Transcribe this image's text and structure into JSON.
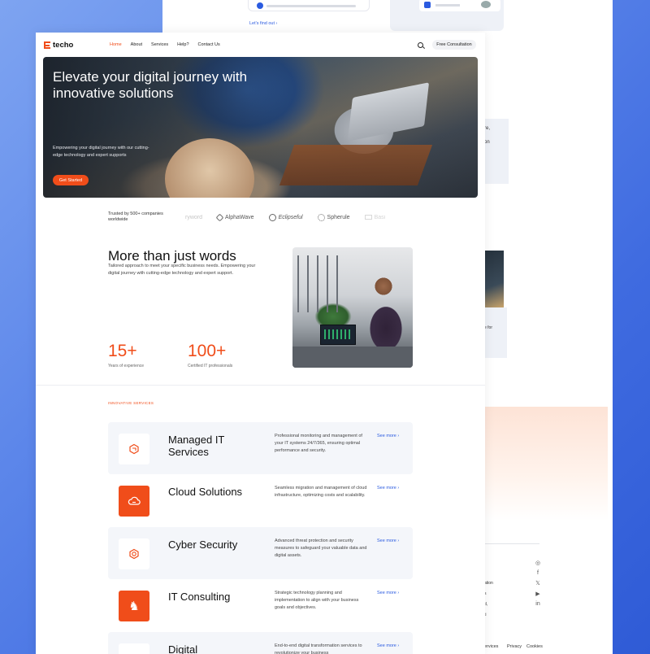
{
  "back_page": {
    "find_out": "Let's find out",
    "side_text_1": [
      "re,",
      "on"
    ],
    "side_text_2": "e for",
    "footer_items": [
      "ation",
      "s",
      "d,",
      "ti"
    ],
    "footer_links": [
      "ervices",
      "Privacy",
      "Cookies"
    ],
    "socials": [
      "instagram-icon",
      "facebook-icon",
      "x-icon",
      "youtube-icon",
      "linkedin-icon"
    ]
  },
  "nav": {
    "logo": "techo",
    "menu": [
      "Home",
      "About",
      "Services",
      "Help?",
      "Contact Us"
    ],
    "active_index": 0,
    "cta": "Free Consultation"
  },
  "hero": {
    "title": "Elevate your digital journey with innovative solutions",
    "subtitle": "Empowering your digital journey with our cutting-edge technology and expert supports",
    "button": "Get Started"
  },
  "trusted": {
    "label": "Trusted by 500+ companies worldwide",
    "logos": [
      "ryword",
      "AlphaWave",
      "Eclipseful",
      "Spherule",
      "Basi"
    ]
  },
  "about": {
    "title": "More than just words",
    "subtitle": "Tailored approach to meet your specific business needs. Empowering your digital journey with cutting-edge technology and expert support.",
    "stats": [
      {
        "value": "15+",
        "label": "Years of experience"
      },
      {
        "value": "100+",
        "label": "Certified IT professionals"
      }
    ]
  },
  "services": {
    "eyebrow": "INNOVATIVE SERVICES",
    "items": [
      {
        "name": "Managed IT Services",
        "desc": "Professional monitoring and management of your IT systems 24/7/365, ensuring optimal performance and security.",
        "more": "See more ›",
        "icon": "hexagon-icon"
      },
      {
        "name": "Cloud Solutions",
        "desc": "Seamless migration and management of cloud infrastructure, optimizing costs and scalability.",
        "more": "See more ›",
        "icon": "cloud-icon"
      },
      {
        "name": "Cyber Security",
        "desc": "Advanced threat protection and security measures to safeguard your valuable data and digital assets.",
        "more": "See more ›",
        "icon": "shield-icon"
      },
      {
        "name": "IT Consulting",
        "desc": "Strategic technology planning and implementation to align with your business goals and objectives.",
        "more": "See more ›",
        "icon": "chess-knight-icon"
      },
      {
        "name": "Digital",
        "desc": "End-to-end digital transformation services to revolutionize your business",
        "more": "See more ›",
        "icon": "digital-icon"
      }
    ]
  },
  "colors": {
    "accent": "#f04d1a",
    "link": "#2b5be0",
    "background": "#4f7be6"
  }
}
